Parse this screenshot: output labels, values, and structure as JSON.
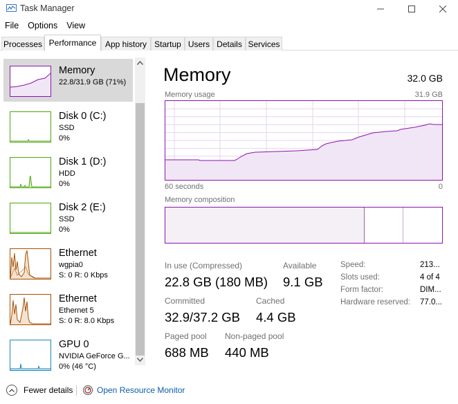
{
  "window": {
    "title": "Task Manager",
    "icon": "task-manager-icon"
  },
  "menu": [
    {
      "label": "File"
    },
    {
      "label": "Options"
    },
    {
      "label": "View"
    }
  ],
  "tabs": [
    {
      "label": "Processes",
      "active": false
    },
    {
      "label": "Performance",
      "active": true
    },
    {
      "label": "App history",
      "active": false
    },
    {
      "label": "Startup",
      "active": false
    },
    {
      "label": "Users",
      "active": false
    },
    {
      "label": "Details",
      "active": false
    },
    {
      "label": "Services",
      "active": false
    }
  ],
  "resources": [
    {
      "name": "Memory",
      "line1": "22.8/31.9 GB (71%)",
      "line2": "",
      "color": "#8b12ae",
      "selected": true
    },
    {
      "name": "Disk 0 (C:)",
      "line1": "SSD",
      "line2": "0%",
      "color": "#4da60c",
      "selected": false
    },
    {
      "name": "Disk 1 (D:)",
      "line1": "HDD",
      "line2": "0%",
      "color": "#4da60c",
      "selected": false
    },
    {
      "name": "Disk 2 (E:)",
      "line1": "SSD",
      "line2": "0%",
      "color": "#4da60c",
      "selected": false
    },
    {
      "name": "Ethernet",
      "line1": "wgpia0",
      "line2": "S: 0 R: 0 Kbps",
      "color": "#a74f01",
      "selected": false
    },
    {
      "name": "Ethernet",
      "line1": "Ethernet 5",
      "line2": "S: 0 R: 8.0 Kbps",
      "color": "#a74f01",
      "selected": false
    },
    {
      "name": "GPU 0",
      "line1": "NVIDIA GeForce G...",
      "line2": "0% (46 °C)",
      "color": "#1a85b6",
      "selected": false
    }
  ],
  "memory": {
    "title": "Memory",
    "total": "32.0 GB",
    "usage_label": "Memory usage",
    "usage_max": "31.9 GB",
    "time_left": "60 seconds",
    "time_right": "0",
    "composition_label": "Memory composition",
    "in_use_label": "In use (Compressed)",
    "in_use_value": "22.8 GB (180 MB)",
    "available_label": "Available",
    "available_value": "9.1 GB",
    "committed_label": "Committed",
    "committed_value": "32.9/37.2 GB",
    "cached_label": "Cached",
    "cached_value": "4.4 GB",
    "paged_label": "Paged pool",
    "paged_value": "688 MB",
    "nonpaged_label": "Non-paged pool",
    "nonpaged_value": "440 MB",
    "details": [
      {
        "label": "Speed:",
        "value": "213..."
      },
      {
        "label": "Slots used:",
        "value": "4 of 4"
      },
      {
        "label": "Form factor:",
        "value": "DIM..."
      },
      {
        "label": "Hardware reserved:",
        "value": "77.0..."
      }
    ]
  },
  "footer": {
    "fewer_details": "Fewer details",
    "open_resource_monitor": "Open Resource Monitor"
  },
  "colors": {
    "memory": "#8b12ae",
    "disk": "#4da60c",
    "ethernet": "#a74f01",
    "gpu": "#1a85b6",
    "link": "#0b5cad"
  }
}
